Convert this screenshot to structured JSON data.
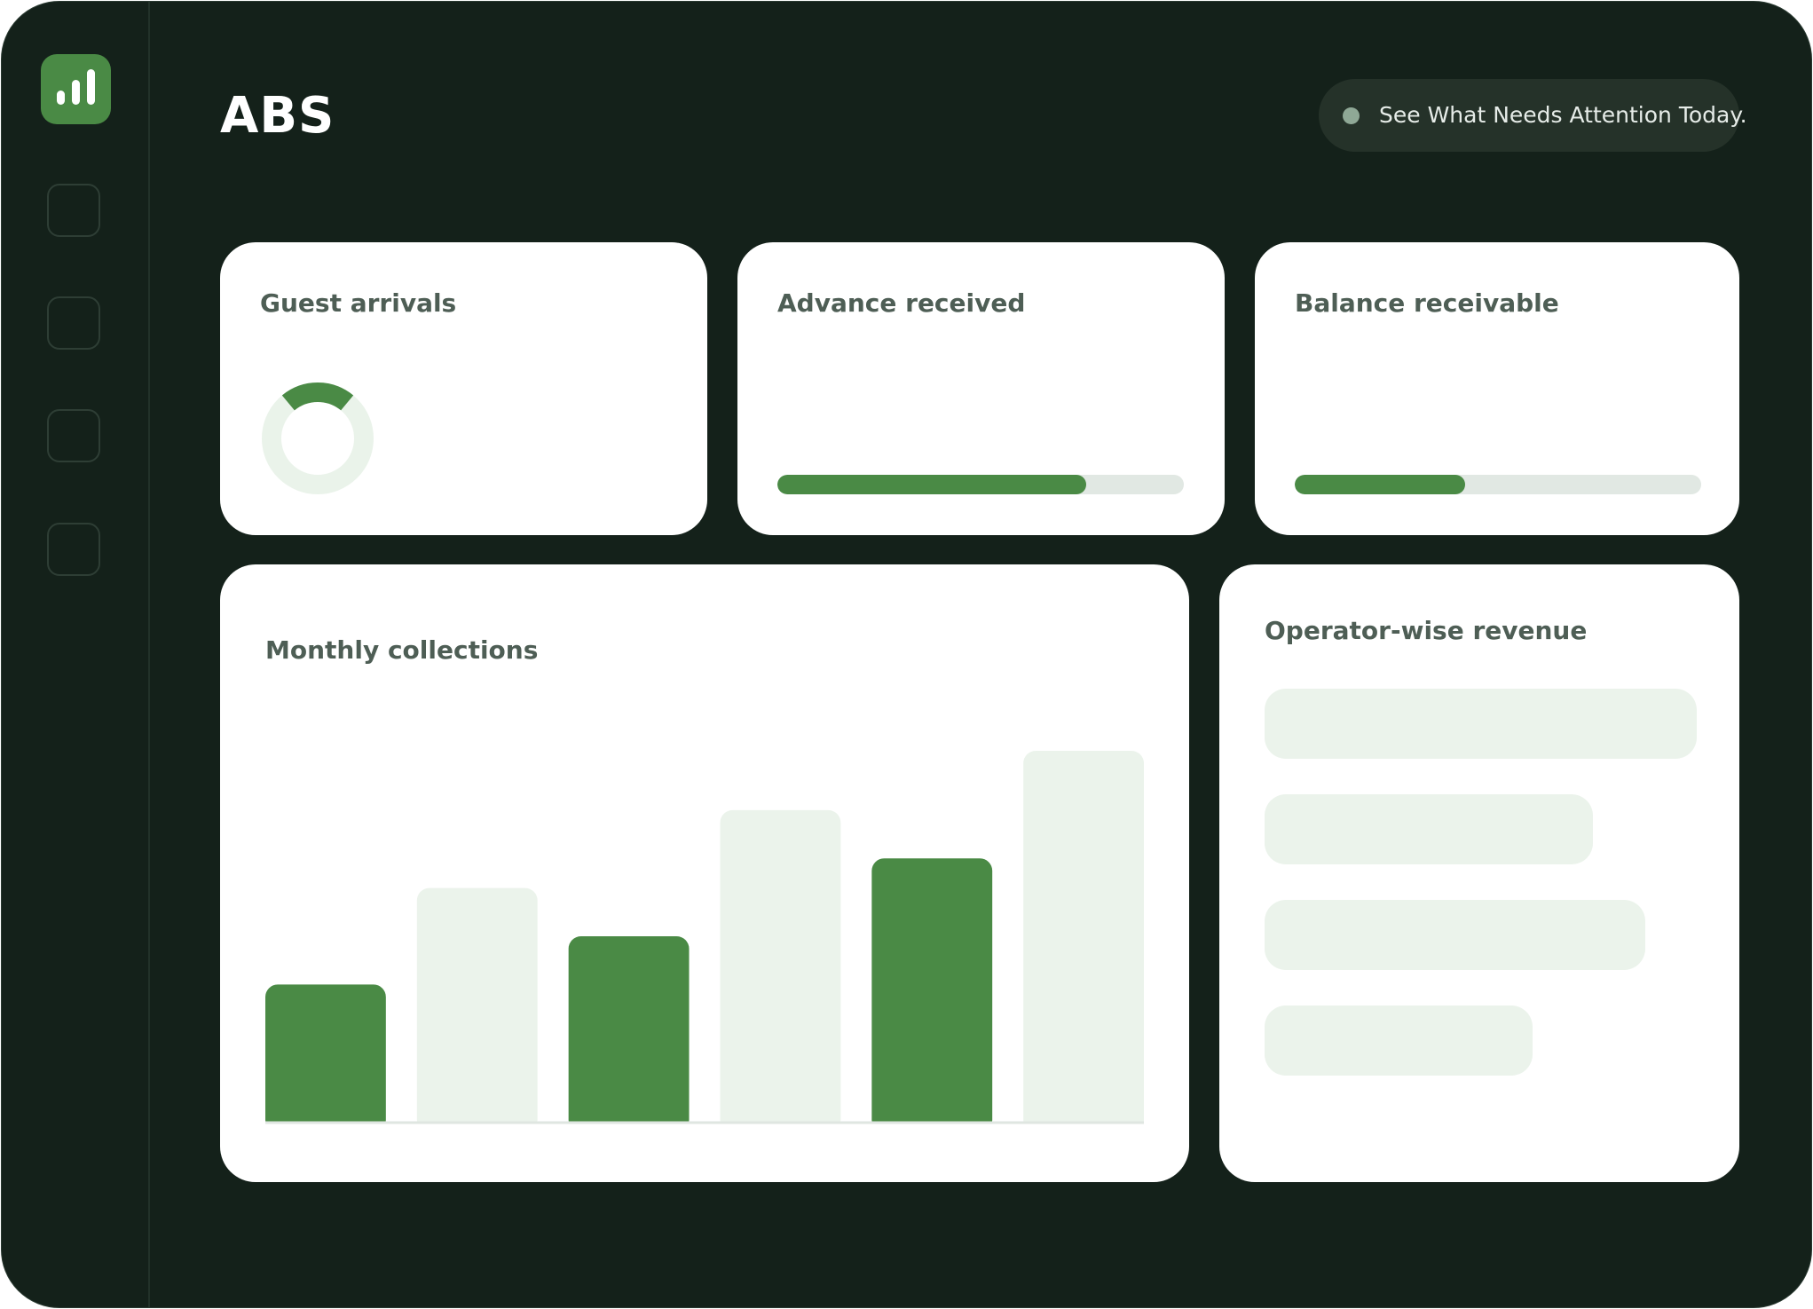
{
  "app": {
    "title": "ABS",
    "banner": "See What Needs Attention Today."
  },
  "colors": {
    "background": "#14211a",
    "accent": "#4a8a45",
    "muted_bar": "#ebf3eb",
    "track": "#e1e8e3"
  },
  "sidebar": {
    "logo_icon": "bar-chart-icon",
    "items": [
      {
        "icon": "placeholder-icon"
      },
      {
        "icon": "placeholder-icon"
      },
      {
        "icon": "placeholder-icon"
      },
      {
        "icon": "placeholder-icon"
      }
    ]
  },
  "cards": {
    "guest_arrivals": {
      "title": "Guest arrivals",
      "progress": 0.22
    },
    "advance_received": {
      "title": "Advance received",
      "progress": 0.76
    },
    "balance_receivable": {
      "title": "Balance receivable",
      "progress": 0.42
    },
    "monthly_collections": {
      "title": "Monthly collections"
    },
    "operator_revenue": {
      "title": "Operator-wise revenue"
    }
  },
  "chart_data": {
    "type": "bar",
    "values": [
      37,
      63,
      50,
      84,
      71,
      100
    ],
    "highlighted": [
      true,
      false,
      true,
      false,
      true,
      false
    ],
    "ylim": [
      0,
      100
    ],
    "grid": false,
    "legend": "none"
  },
  "operator_revenue": {
    "values": [
      1.0,
      0.76,
      0.88,
      0.62
    ]
  }
}
